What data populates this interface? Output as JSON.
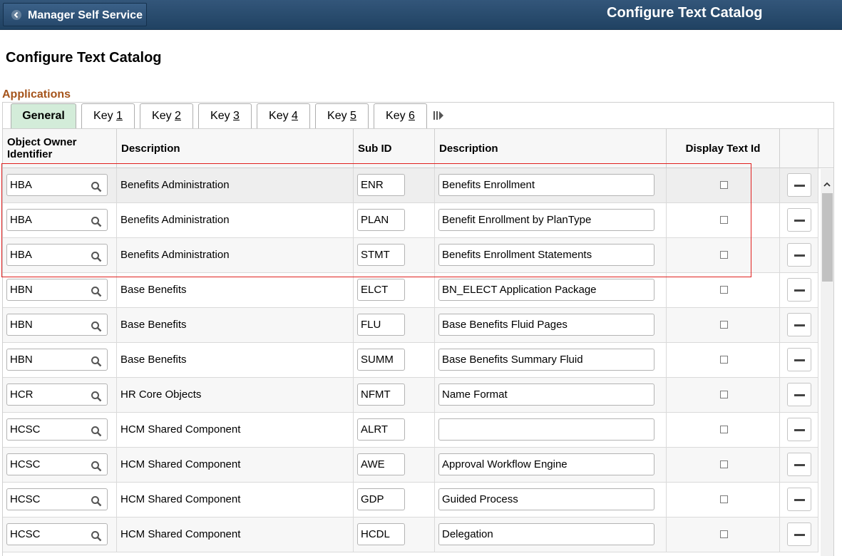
{
  "header": {
    "back_label": "Manager Self Service",
    "title": "Configure Text Catalog"
  },
  "page": {
    "title": "Configure Text Catalog",
    "section": "Applications"
  },
  "tabs": [
    {
      "label": "General",
      "key_prefix": "",
      "key_num": "",
      "active": true
    },
    {
      "label": "",
      "key_prefix": "Key ",
      "key_num": "1"
    },
    {
      "label": "",
      "key_prefix": "Key ",
      "key_num": "2"
    },
    {
      "label": "",
      "key_prefix": "Key ",
      "key_num": "3"
    },
    {
      "label": "",
      "key_prefix": "Key ",
      "key_num": "4"
    },
    {
      "label": "",
      "key_prefix": "Key ",
      "key_num": "5"
    },
    {
      "label": "",
      "key_prefix": "Key ",
      "key_num": "6"
    }
  ],
  "columns": {
    "owner": "Object Owner Identifier",
    "owner_desc": "Description",
    "sub_id": "Sub ID",
    "sub_desc": "Description",
    "display_text_id": "Display Text Id"
  },
  "rows": [
    {
      "owner": "HBA",
      "owner_desc": "Benefits Administration",
      "sub_id": "ENR",
      "sub_desc": "Benefits Enrollment"
    },
    {
      "owner": "HBA",
      "owner_desc": "Benefits Administration",
      "sub_id": "PLAN",
      "sub_desc": "Benefit Enrollment by PlanType"
    },
    {
      "owner": "HBA",
      "owner_desc": "Benefits Administration",
      "sub_id": "STMT",
      "sub_desc": "Benefits Enrollment Statements"
    },
    {
      "owner": "HBN",
      "owner_desc": "Base Benefits",
      "sub_id": "ELCT",
      "sub_desc": "BN_ELECT Application Package"
    },
    {
      "owner": "HBN",
      "owner_desc": "Base Benefits",
      "sub_id": "FLU",
      "sub_desc": "Base Benefits Fluid Pages"
    },
    {
      "owner": "HBN",
      "owner_desc": "Base Benefits",
      "sub_id": "SUMM",
      "sub_desc": "Base Benefits Summary Fluid"
    },
    {
      "owner": "HCR",
      "owner_desc": "HR Core Objects",
      "sub_id": "NFMT",
      "sub_desc": "Name Format"
    },
    {
      "owner": "HCSC",
      "owner_desc": "HCM Shared Component",
      "sub_id": "ALRT",
      "sub_desc": ""
    },
    {
      "owner": "HCSC",
      "owner_desc": "HCM Shared Component",
      "sub_id": "AWE",
      "sub_desc": "Approval Workflow Engine"
    },
    {
      "owner": "HCSC",
      "owner_desc": "HCM Shared Component",
      "sub_id": "GDP",
      "sub_desc": "Guided Process"
    },
    {
      "owner": "HCSC",
      "owner_desc": "HCM Shared Component",
      "sub_id": "HCDL",
      "sub_desc": "Delegation"
    }
  ],
  "icons": {
    "back": "chevron-left-icon",
    "lookup": "search-icon",
    "delete": "minus-icon",
    "more_tabs": "show-all-tabs-icon"
  }
}
